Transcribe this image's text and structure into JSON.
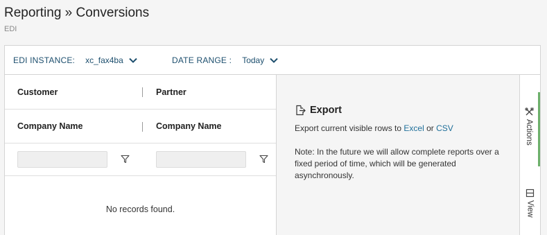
{
  "page": {
    "title": "Reporting » Conversions",
    "subtitle": "EDI"
  },
  "filters": [
    {
      "label": "EDI INSTANCE:",
      "value": "xc_fax4ba",
      "active": true
    },
    {
      "label": "DATE RANGE :",
      "value": "Today",
      "active": false
    }
  ],
  "grid": {
    "group_headers": [
      "Customer",
      "Partner"
    ],
    "column_headers": [
      "Company Name",
      "Company Name"
    ],
    "filter_icon": "funnel-icon",
    "empty_message": "No records found."
  },
  "export": {
    "icon": "export-icon",
    "title": "Export",
    "text_prefix": "Export current visible rows to",
    "link_excel": "Excel",
    "text_or": "or",
    "link_csv": "CSV",
    "note": "Note: In the future we will allow complete reports over a fixed period of time, which will be generated asynchronously."
  },
  "side_tabs": [
    {
      "label": "Actions",
      "icon": "tools-icon",
      "active": true
    },
    {
      "label": "View",
      "icon": "columns-icon",
      "active": false
    }
  ],
  "colors": {
    "accent": "#1d4f6e",
    "link": "#1f6f9a",
    "active_tab_marker": "#6db06b"
  }
}
